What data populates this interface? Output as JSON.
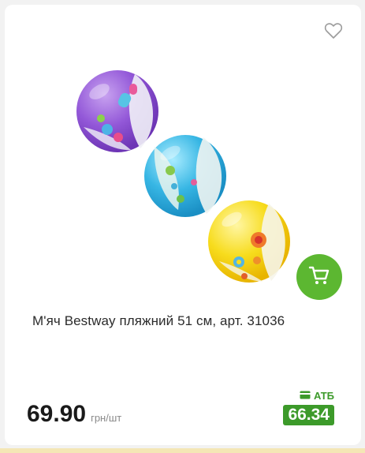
{
  "product": {
    "title": "М'яч Bestway пляжний 51 см, арт. 31036",
    "price": "69.90",
    "unit": "грн/шт",
    "promo_label": "АТБ",
    "promo_price": "66.34"
  },
  "icons": {
    "favorite": "heart-icon",
    "cart": "cart-icon",
    "card": "card-icon"
  },
  "colors": {
    "accent_green": "#5cb731",
    "promo_green": "#3c9a2a"
  }
}
